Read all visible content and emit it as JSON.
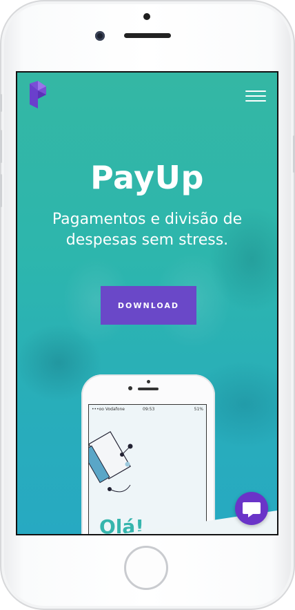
{
  "hero": {
    "title": "PayUp",
    "subtitle": "Pagamentos e divisão de despesas sem stress.",
    "download_label": "DOWNLOAD"
  },
  "mockup": {
    "carrier": "•••oo Vodafone",
    "time": "09:53",
    "battery": "51%",
    "greeting": "Olá!"
  },
  "icons": {
    "logo": "payup-logo-icon",
    "menu": "hamburger-menu-icon",
    "chat": "chat-bubble-icon"
  },
  "colors": {
    "accent": "#6a48c8",
    "teal": "#34b7a4",
    "greeting": "#36b5ad"
  }
}
